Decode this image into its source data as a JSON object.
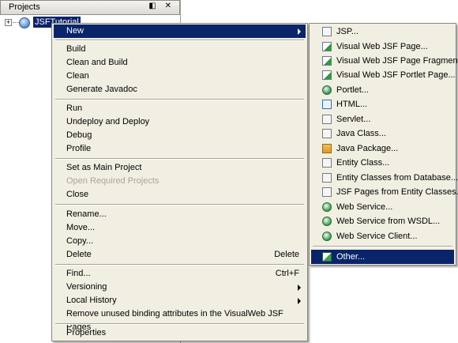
{
  "panel": {
    "title": "Projects",
    "buttons": "◧ ✕",
    "project_label": "JSFTutorial",
    "expander": "+"
  },
  "menu": {
    "items": [
      {
        "label": "New",
        "submenu": true,
        "selected": true
      },
      {
        "label": "Build"
      },
      {
        "label": "Clean and Build"
      },
      {
        "label": "Clean"
      },
      {
        "label": "Generate Javadoc"
      },
      {
        "label": "Run"
      },
      {
        "label": "Undeploy and Deploy"
      },
      {
        "label": "Debug"
      },
      {
        "label": "Profile"
      },
      {
        "label": "Set as Main Project"
      },
      {
        "label": "Open Required Projects",
        "disabled": true
      },
      {
        "label": "Close"
      },
      {
        "label": "Rename..."
      },
      {
        "label": "Move..."
      },
      {
        "label": "Copy..."
      },
      {
        "label": "Delete",
        "shortcut": "Delete"
      },
      {
        "label": "Find...",
        "shortcut": "Ctrl+F"
      },
      {
        "label": "Versioning",
        "submenu": true
      },
      {
        "label": "Local History",
        "submenu": true
      },
      {
        "label": "Remove unused binding attributes in the VisualWeb JSF Pages"
      },
      {
        "label": "Properties"
      }
    ]
  },
  "submenu": {
    "items": [
      {
        "label": "JSP...",
        "icon": "page-icon"
      },
      {
        "label": "Visual Web JSF Page...",
        "icon": "jsf-page-icon"
      },
      {
        "label": "Visual Web JSF Page Fragment...",
        "icon": "jsf-fragment-icon"
      },
      {
        "label": "Visual Web JSF Portlet Page...",
        "icon": "jsf-portlet-icon"
      },
      {
        "label": "Portlet...",
        "icon": "portlet-globe-icon"
      },
      {
        "label": "HTML...",
        "icon": "html-icon"
      },
      {
        "label": "Servlet...",
        "icon": "servlet-icon"
      },
      {
        "label": "Java Class...",
        "icon": "java-class-icon"
      },
      {
        "label": "Java Package...",
        "icon": "package-icon"
      },
      {
        "label": "Entity Class...",
        "icon": "entity-class-icon"
      },
      {
        "label": "Entity Classes from Database...",
        "icon": "entity-db-icon"
      },
      {
        "label": "JSF Pages from Entity Classes...",
        "icon": "jsf-entity-pages-icon"
      },
      {
        "label": "Web Service...",
        "icon": "web-service-icon"
      },
      {
        "label": "Web Service from WSDL...",
        "icon": "wsdl-icon"
      },
      {
        "label": "Web Service Client...",
        "icon": "ws-client-icon"
      },
      {
        "label": "Other...",
        "icon": "other-icon",
        "selected": true
      }
    ]
  },
  "colors": {
    "selection": "#0a246a",
    "menu_bg": "#f1efe2",
    "disabled_text": "#a9a699"
  }
}
